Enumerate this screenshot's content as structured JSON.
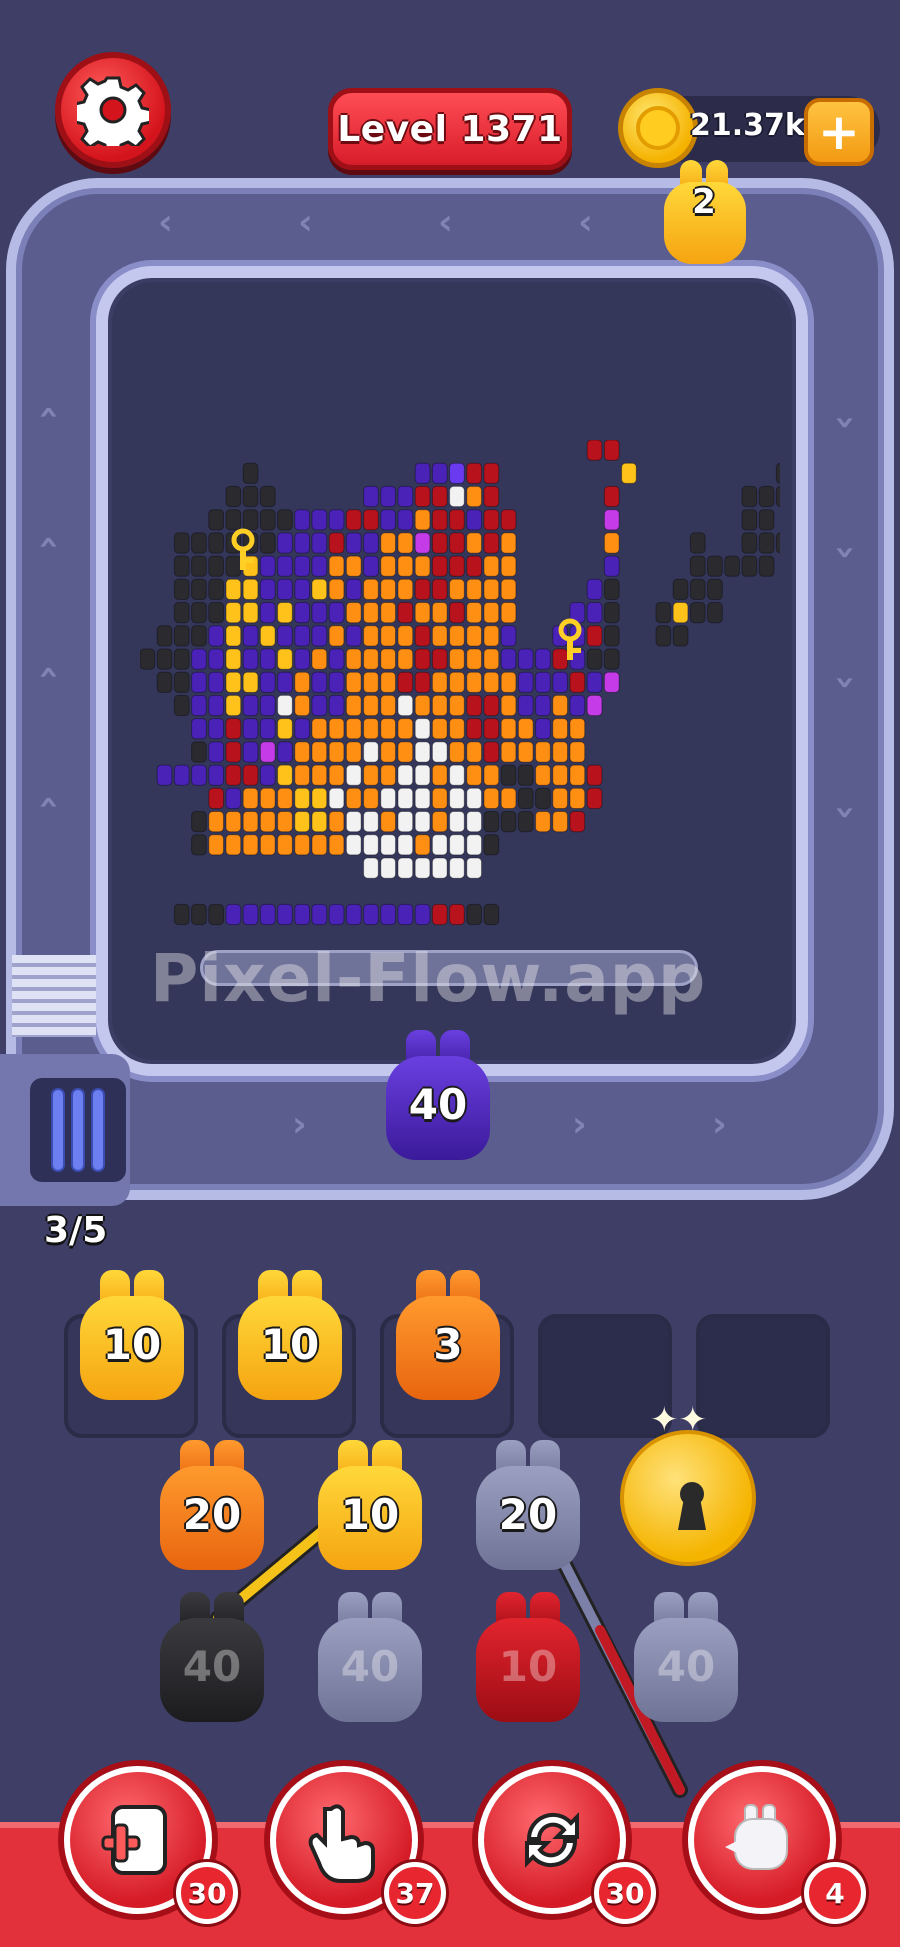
{
  "header": {
    "level_label": "Level 1371",
    "coins": "21.37k",
    "add_coins_symbol": "+"
  },
  "conveyor": {
    "top_creature_count": "2",
    "active_shooter_count": "40",
    "progress": "3/5",
    "watermark": "Pixel-Flow.app"
  },
  "queue": [
    {
      "count": "10",
      "color": "yellow"
    },
    {
      "count": "10",
      "color": "yellow"
    },
    {
      "count": "3",
      "color": "orange"
    },
    {
      "count": "",
      "color": "empty"
    },
    {
      "count": "",
      "color": "empty"
    }
  ],
  "grid": {
    "row1": [
      {
        "count": "20",
        "color": "orange"
      },
      {
        "count": "10",
        "color": "yellow"
      },
      {
        "count": "20",
        "color": "gray"
      },
      {
        "count": "",
        "color": "key",
        "icon": "keyhole-icon"
      }
    ],
    "row2": [
      {
        "count": "40",
        "color": "black"
      },
      {
        "count": "40",
        "color": "gray"
      },
      {
        "count": "10",
        "color": "red"
      },
      {
        "count": "40",
        "color": "gray"
      }
    ]
  },
  "powerups": [
    {
      "name": "add-slot",
      "icon": "add-slot-icon",
      "count": "30"
    },
    {
      "name": "hand",
      "icon": "hand-pointer-icon",
      "count": "37"
    },
    {
      "name": "shuffle",
      "icon": "shuffle-icon",
      "count": "30"
    },
    {
      "name": "creature",
      "icon": "ghost-creature-icon",
      "count": "4"
    }
  ],
  "colors": {
    "accent_red": "#e2313a",
    "coin_gold": "#f5b200",
    "background": "#3e3e66",
    "track": "#5b5d8e"
  }
}
